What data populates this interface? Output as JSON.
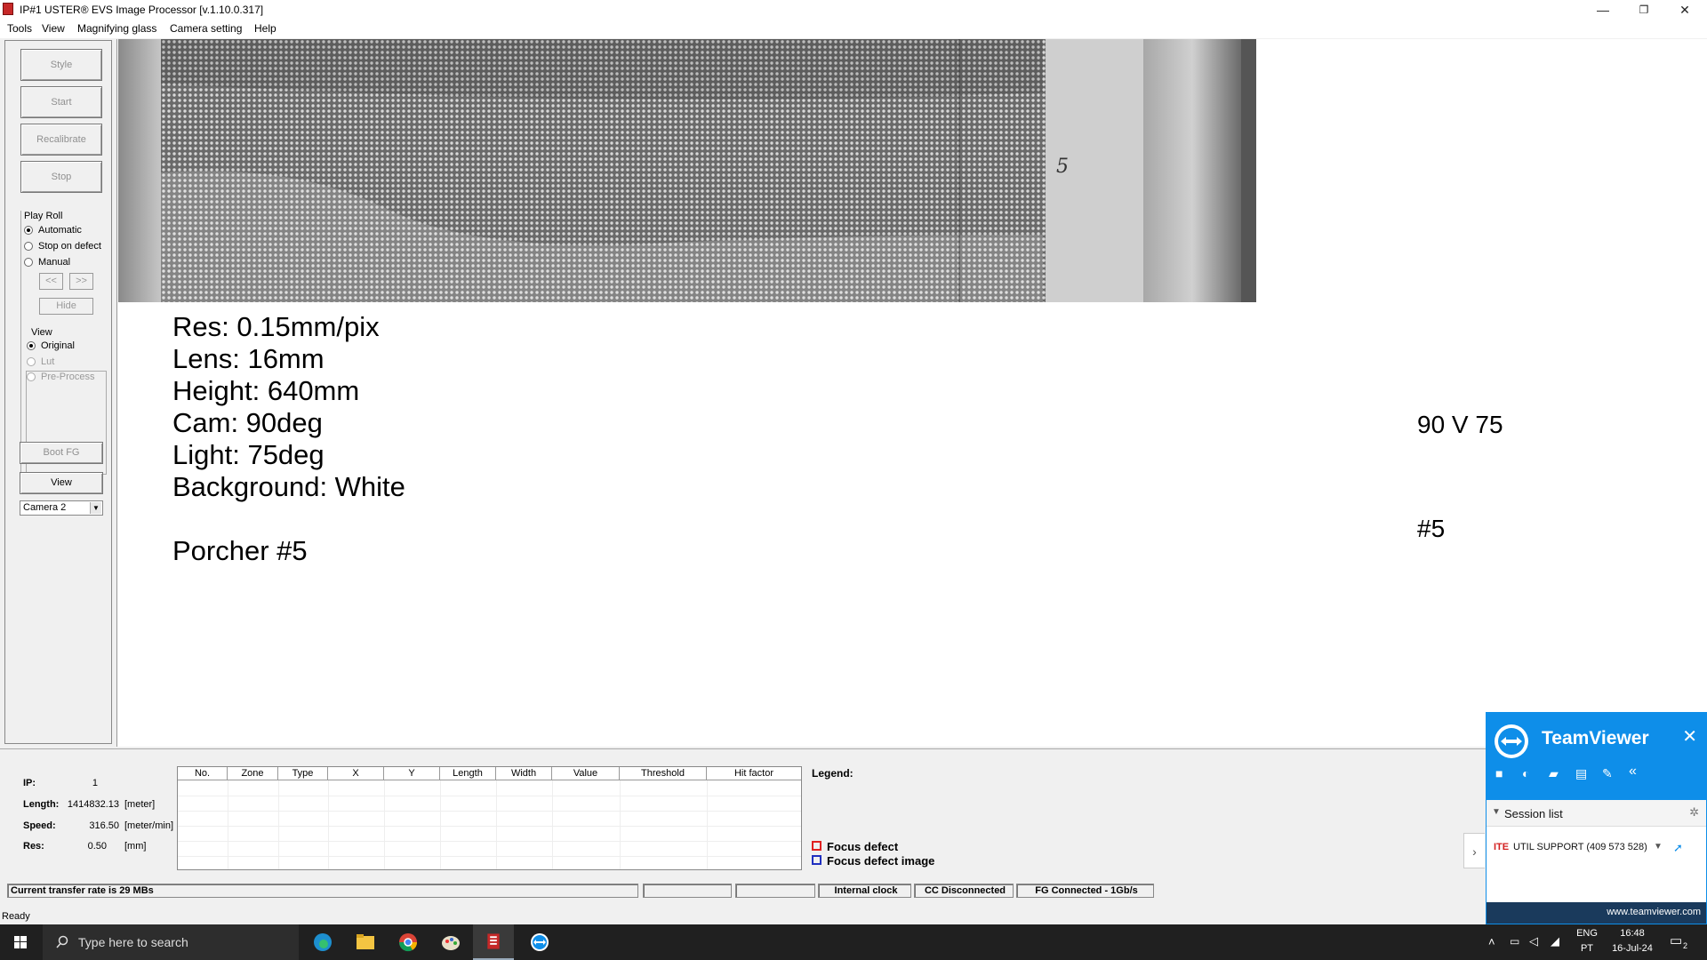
{
  "window": {
    "title": "IP#1  USTER® EVS Image Processor [v.1.10.0.317]",
    "minimize": "—",
    "restore": "❐",
    "close": "✕"
  },
  "menu": [
    "Tools",
    "View",
    "Magnifying glass",
    "Camera setting",
    "Help"
  ],
  "left_panel": {
    "buttons": [
      "Style",
      "Start",
      "Recalibrate",
      "Stop"
    ],
    "play_roll": {
      "title": "Play Roll",
      "options": [
        "Automatic",
        "Stop on defect",
        "Manual"
      ],
      "selected": "Automatic",
      "prev": "<<",
      "next": ">>",
      "hide": "Hide"
    },
    "view": {
      "title": "View",
      "options": [
        "Original",
        "Lut",
        "Pre-Process"
      ],
      "selected": "Original"
    },
    "boot_fg": "Boot FG",
    "view_button": "View",
    "camera": "Camera 2"
  },
  "image_overlay": {
    "lines": [
      "Res: 0.15mm/pix",
      "Lens: 16mm",
      "Height: 640mm",
      "Cam: 90deg",
      "Light: 75deg",
      "Background: White"
    ],
    "sample": "Porcher #5",
    "roll_mark": "5",
    "side_note_1": "90 V 75",
    "side_note_2": "#5"
  },
  "stats": {
    "ip_label": "IP:",
    "ip_value": "1",
    "length_label": "Length:",
    "length_value": "1414832.13",
    "length_unit": "[meter]",
    "speed_label": "Speed:",
    "speed_value": "316.50",
    "speed_unit": "[meter/min]",
    "res_label": "Res:",
    "res_value": "0.50",
    "res_unit": "[mm]"
  },
  "defect_table": {
    "columns": [
      "No.",
      "Zone",
      "Type",
      "X",
      "Y",
      "Length",
      "Width",
      "Value",
      "Threshold",
      "Hit factor"
    ]
  },
  "legend": {
    "title": "Legend:",
    "items": [
      {
        "label": "Focus defect",
        "color": "#e02020"
      },
      {
        "label": "Focus defect image",
        "color": "#2030c0"
      }
    ]
  },
  "statusbar": {
    "transfer": "Current transfer rate is 29 MBs",
    "clock": "Internal clock",
    "cc": "CC Disconnected",
    "fg": "FG Connected - 1Gb/s",
    "ready": "Ready"
  },
  "taskbar": {
    "search_placeholder": "Type here to search",
    "lang_1": "ENG",
    "lang_2": "PT",
    "time": "16:48",
    "date": "16-Jul-24",
    "notifications": "2"
  },
  "teamviewer": {
    "title": "TeamViewer",
    "session_list": "Session list",
    "session_item": "UTIL SUPPORT (409 573 528)",
    "url": "www.teamviewer.com",
    "brand_color": "#0e8ee9"
  }
}
